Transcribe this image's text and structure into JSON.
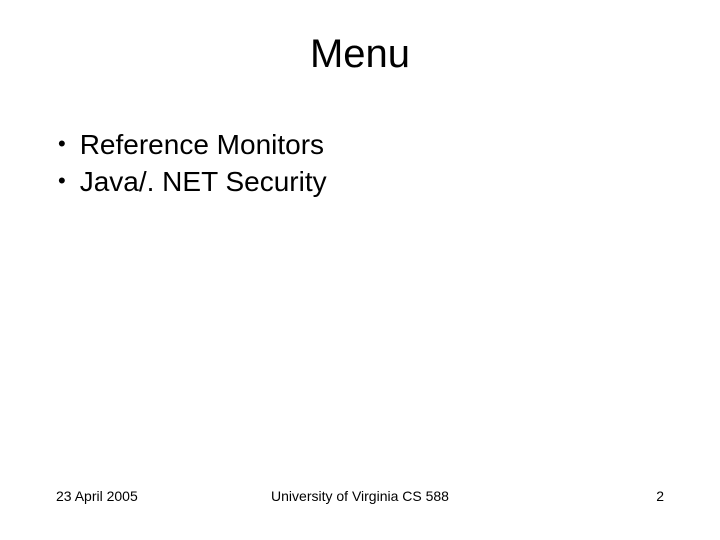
{
  "title": "Menu",
  "bullets": {
    "0": "Reference Monitors",
    "1": "Java/. NET Security"
  },
  "footer": {
    "date": "23 April 2005",
    "course": "University of Virginia CS 588",
    "page": "2"
  }
}
